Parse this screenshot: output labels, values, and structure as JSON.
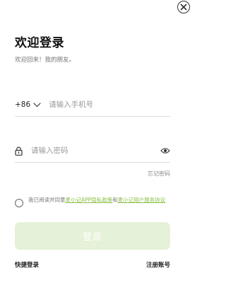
{
  "header": {
    "close_icon": "close-icon",
    "title": "欢迎登录",
    "subtitle": "欢迎回来！我的朋友。"
  },
  "phone": {
    "country_code": "+86",
    "dropdown_icon": "chevron-down-icon",
    "placeholder": "请输入手机号",
    "value": ""
  },
  "password": {
    "lock_icon": "lock-icon",
    "placeholder": "请输入密码",
    "value": "",
    "visibility_icon": "eye-icon"
  },
  "forgot_password": "忘记密码",
  "agreement": {
    "checked": false,
    "prefix": "我已阅读并同意",
    "privacy_link": "麦小记APP隐私政策",
    "connector": "和",
    "terms_link": "麦小记用户服务协议"
  },
  "login_button": "登录",
  "quick_login": "快捷登录",
  "register": "注册账号",
  "colors": {
    "accent": "#8bbf47",
    "button_disabled_bg": "#e5f1d8",
    "text_primary": "#111111",
    "text_secondary": "#777777"
  }
}
